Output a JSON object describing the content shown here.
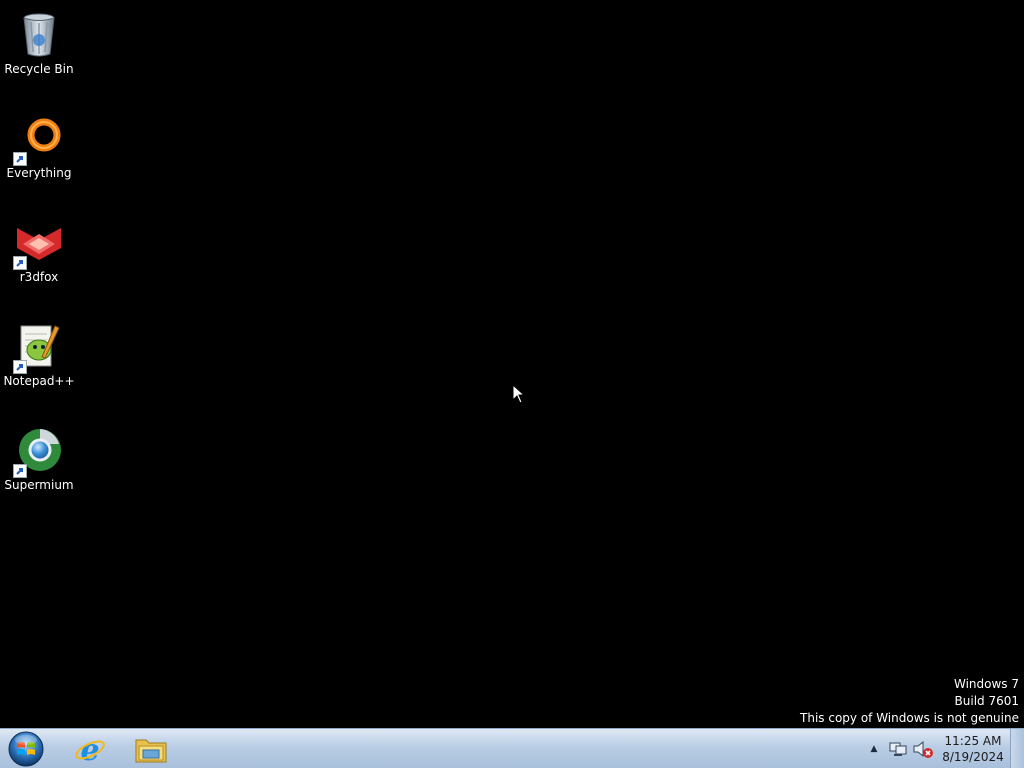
{
  "desktop": {
    "icons": [
      {
        "label": "Recycle Bin",
        "icon": "recycle-bin-icon"
      },
      {
        "label": "Everything",
        "icon": "everything-icon"
      },
      {
        "label": "r3dfox",
        "icon": "r3dfox-icon"
      },
      {
        "label": "Notepad++",
        "icon": "notepad-plus-plus-icon"
      },
      {
        "label": "Supermium",
        "icon": "supermium-icon"
      }
    ],
    "watermark": {
      "line1": "Windows 7",
      "line2": "Build 7601",
      "line3": "This copy of Windows is not genuine"
    },
    "background_color": "#000000"
  },
  "taskbar": {
    "start_icon": "windows-start-orb-icon",
    "pinned": [
      {
        "icon": "internet-explorer-icon"
      },
      {
        "icon": "windows-explorer-icon"
      }
    ],
    "tray": {
      "overflow_symbol": "▲",
      "network_icon": "network-icon",
      "volume_icon": "volume-muted-icon"
    },
    "clock": {
      "time": "11:25 AM",
      "date": "8/19/2024"
    }
  }
}
